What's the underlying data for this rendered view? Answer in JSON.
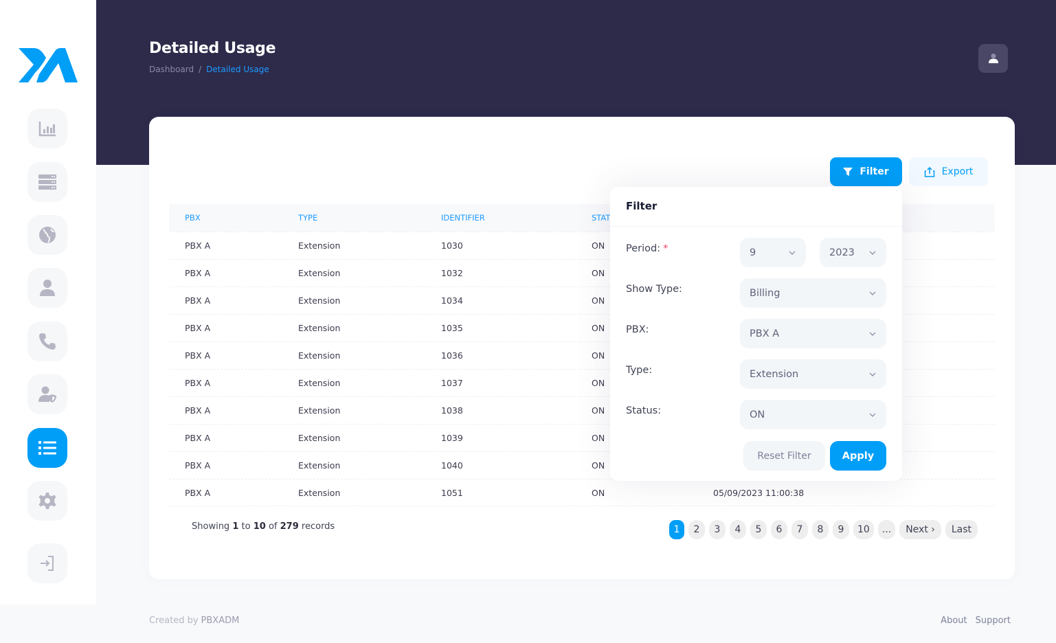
{
  "header": {
    "title": "Detailed Usage",
    "breadcrumb": [
      {
        "label": "Dashboard"
      },
      {
        "label": "Detailed Usage"
      }
    ],
    "breadcrumb_separator": "/"
  },
  "sidebar": {
    "items": [
      {
        "icon": "chart-bar-icon",
        "active": false
      },
      {
        "icon": "server-icon",
        "active": false
      },
      {
        "icon": "globe-icon",
        "active": false
      },
      {
        "icon": "user-icon",
        "active": false
      },
      {
        "icon": "phone-icon",
        "active": false
      },
      {
        "icon": "user-shield-icon",
        "active": false
      },
      {
        "icon": "list-icon",
        "active": true
      },
      {
        "icon": "gear-icon",
        "active": false
      },
      {
        "icon": "sign-in-icon",
        "active": false
      }
    ]
  },
  "toolbar": {
    "filter_label": "Filter",
    "export_label": "Export"
  },
  "table": {
    "columns": [
      "PBX",
      "TYPE",
      "IDENTIFIER",
      "STAT"
    ],
    "rows": [
      {
        "pbx": "PBX A",
        "type": "Extension",
        "identifier": "1030",
        "status": "ON",
        "date": ""
      },
      {
        "pbx": "PBX A",
        "type": "Extension",
        "identifier": "1032",
        "status": "ON",
        "date": ""
      },
      {
        "pbx": "PBX A",
        "type": "Extension",
        "identifier": "1034",
        "status": "ON",
        "date": ""
      },
      {
        "pbx": "PBX A",
        "type": "Extension",
        "identifier": "1035",
        "status": "ON",
        "date": ""
      },
      {
        "pbx": "PBX A",
        "type": "Extension",
        "identifier": "1036",
        "status": "ON",
        "date": ""
      },
      {
        "pbx": "PBX A",
        "type": "Extension",
        "identifier": "1037",
        "status": "ON",
        "date": ""
      },
      {
        "pbx": "PBX A",
        "type": "Extension",
        "identifier": "1038",
        "status": "ON",
        "date": ""
      },
      {
        "pbx": "PBX A",
        "type": "Extension",
        "identifier": "1039",
        "status": "ON",
        "date": ""
      },
      {
        "pbx": "PBX A",
        "type": "Extension",
        "identifier": "1040",
        "status": "ON",
        "date": ""
      },
      {
        "pbx": "PBX A",
        "type": "Extension",
        "identifier": "1051",
        "status": "ON",
        "date": "05/09/2023 11:00:38"
      }
    ]
  },
  "records": {
    "prefix": "Showing",
    "from": "1",
    "to_word": "to",
    "to": "10",
    "of_word": "of",
    "total": "279",
    "suffix": "records"
  },
  "pagination": {
    "pages": [
      "1",
      "2",
      "3",
      "4",
      "5",
      "6",
      "7",
      "8",
      "9",
      "10"
    ],
    "current": "1",
    "ellipsis": "...",
    "next_label": "Next ›",
    "last_label": "Last"
  },
  "filter_popup": {
    "title": "Filter",
    "period_label": "Period:",
    "required_mark": "*",
    "period_month": "9",
    "period_year": "2023",
    "show_type_label": "Show Type:",
    "show_type_value": "Billing",
    "pbx_label": "PBX:",
    "pbx_value": "PBX A",
    "type_label": "Type:",
    "type_value": "Extension",
    "status_label": "Status:",
    "status_value": "ON",
    "reset_label": "Reset Filter",
    "apply_label": "Apply"
  },
  "footer": {
    "created_by": "Created by",
    "brand": "PBXADM",
    "links": [
      "About",
      "Support"
    ]
  },
  "colors": {
    "accent": "#009ef7",
    "header_bg": "#2d2a4a",
    "required": "#f1416c"
  }
}
